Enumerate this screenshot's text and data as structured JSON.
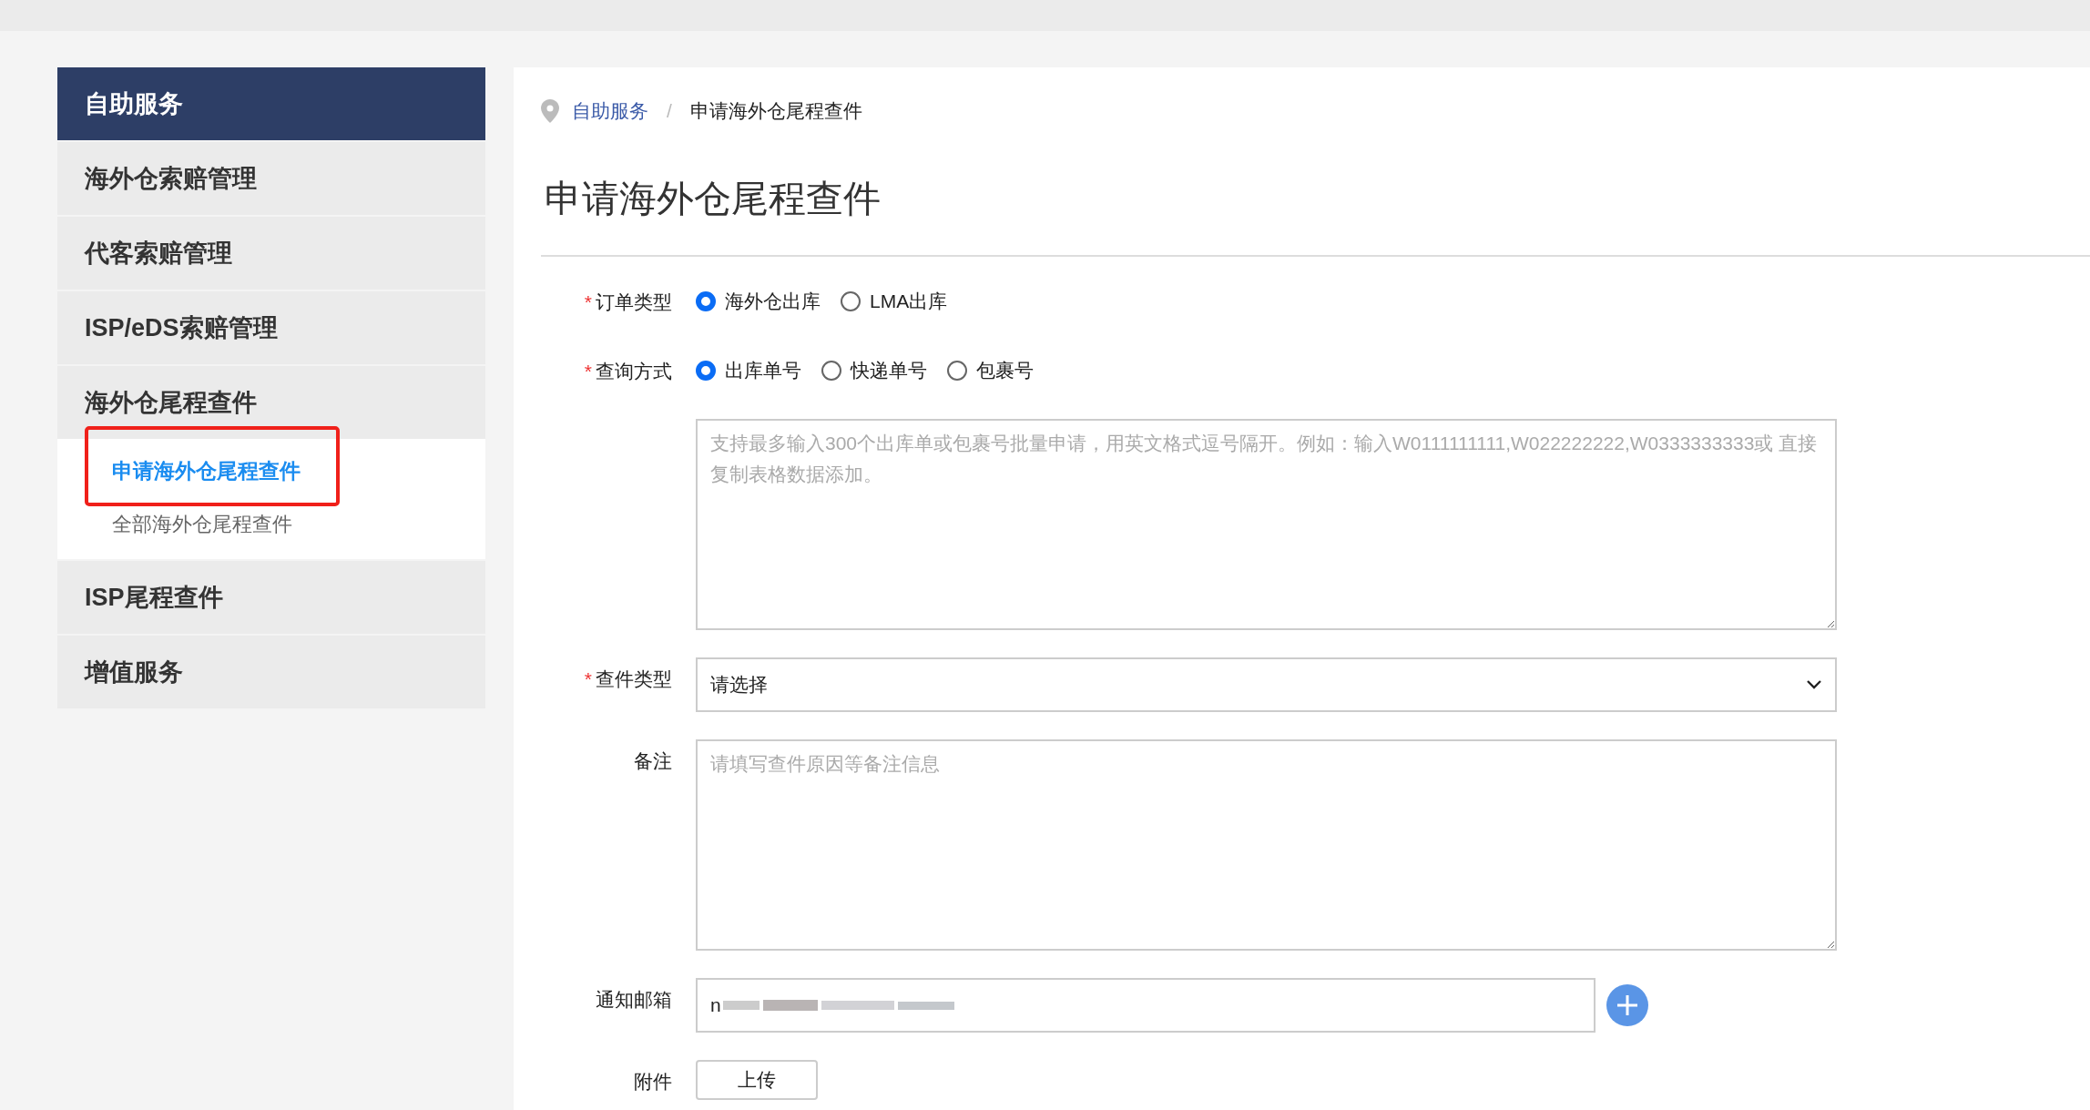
{
  "sidebar": {
    "header": "自助服务",
    "items": [
      {
        "label": "海外仓索赔管理"
      },
      {
        "label": "代客索赔管理"
      },
      {
        "label": "ISP/eDS索赔管理"
      },
      {
        "label": "海外仓尾程查件",
        "children": [
          {
            "label": "申请海外仓尾程查件",
            "selected": true
          },
          {
            "label": "全部海外仓尾程查件",
            "selected": false
          }
        ]
      },
      {
        "label": "ISP尾程查件"
      },
      {
        "label": "增值服务"
      }
    ]
  },
  "breadcrumb": [
    {
      "label": "自助服务",
      "kind": "link"
    },
    {
      "label": "/",
      "kind": "separator"
    },
    {
      "label": "申请海外仓尾程查件",
      "kind": "current"
    }
  ],
  "page_title": "申请海外仓尾程查件",
  "form": [
    {
      "kind": "radio",
      "required_mark": "*",
      "label": "订单类型",
      "options": [
        {
          "label": "海外仓出库",
          "selected": true
        },
        {
          "label": "LMA出库",
          "selected": false
        }
      ]
    },
    {
      "kind": "radio",
      "required_mark": "*",
      "label": "查询方式",
      "options": [
        {
          "label": "出库单号",
          "selected": true
        },
        {
          "label": "快递单号",
          "selected": false
        },
        {
          "label": "包裹号",
          "selected": false
        }
      ]
    },
    {
      "kind": "textarea",
      "placeholder": "支持最多输入300个出库单或包裹号批量申请，用英文格式逗号隔开。例如：输入W0111111111,W022222222,W0333333333或 直接复制表格数据添加。"
    },
    {
      "kind": "select",
      "required_mark": "*",
      "label": "查件类型",
      "value": "请选择"
    },
    {
      "kind": "textarea",
      "label": "备注",
      "placeholder": "请填写查件原因等备注信息"
    },
    {
      "kind": "email",
      "label": "通知邮箱",
      "value": "n"
    },
    {
      "kind": "upload",
      "label": "附件",
      "button": "上传"
    }
  ]
}
